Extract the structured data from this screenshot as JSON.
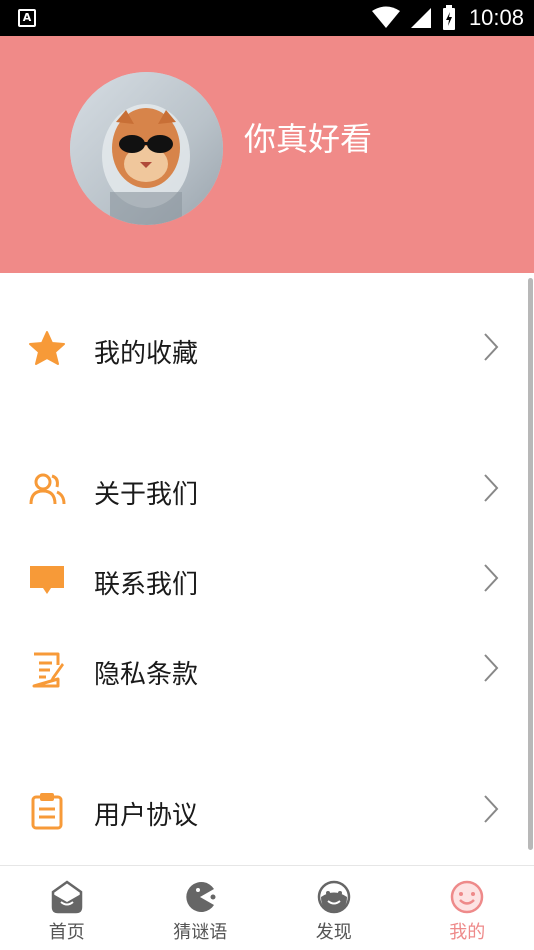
{
  "status_bar": {
    "app_badge": "A",
    "time": "10:08"
  },
  "profile": {
    "username": "你真好看"
  },
  "menu": {
    "items": [
      {
        "label": "我的收藏",
        "icon": "star-icon"
      },
      {
        "label": "关于我们",
        "icon": "users-icon"
      },
      {
        "label": "联系我们",
        "icon": "message-icon"
      },
      {
        "label": "隐私条款",
        "icon": "document-edit-icon"
      },
      {
        "label": "用户协议",
        "icon": "clipboard-icon"
      }
    ]
  },
  "bottom_nav": {
    "items": [
      {
        "label": "首页",
        "icon": "home-face-icon"
      },
      {
        "label": "猜谜语",
        "icon": "pacman-icon"
      },
      {
        "label": "发现",
        "icon": "discover-face-icon"
      },
      {
        "label": "我的",
        "icon": "smile-face-icon"
      }
    ],
    "active_index": 3
  },
  "colors": {
    "header_bg": "#f08a88",
    "icon_orange": "#f79a38",
    "active_pink": "#ee8a8a"
  }
}
